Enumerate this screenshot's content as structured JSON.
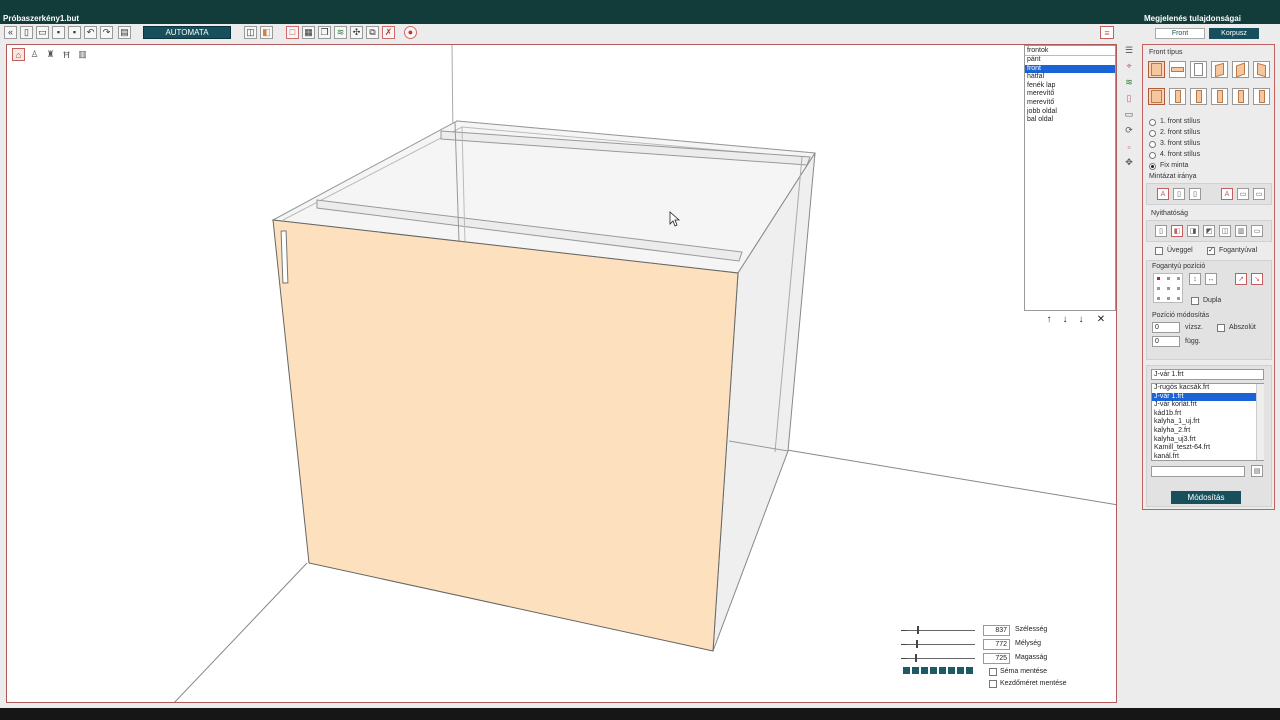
{
  "window": {
    "title": "Próbaszerkény1.but",
    "panel_title": "Megjelenés tulajdonságai"
  },
  "toolbar": {
    "mode_label": "AUTOMATA"
  },
  "fronts_list": {
    "title": "frontok",
    "items": [
      "pánt",
      "front",
      "hátfal",
      "fenék lap",
      "merevítő",
      "merevítő",
      "jobb oldal",
      "bal oldal"
    ],
    "selected_index": 1
  },
  "dimensions": {
    "width": {
      "value": "837",
      "label": "Szélesség",
      "slider": 0.2
    },
    "depth": {
      "value": "772",
      "label": "Mélység",
      "slider": 0.18
    },
    "height": {
      "value": "725",
      "label": "Magasság",
      "slider": 0.16
    },
    "save_scheme_label": "Séma mentése",
    "save_initial_size_label": "Kezdőméret mentése"
  },
  "props": {
    "tab_front": "Front",
    "tab_korpusz": "Korpusz",
    "front_type_label": "Front típus",
    "style_options": [
      "1. front stílus",
      "2. front stílus",
      "3. front stílus",
      "4. front stílus",
      "Fix minta"
    ],
    "style_selected": 4,
    "pattern_direction_label": "Mintázat iránya",
    "opening_label": "Nyithatóság",
    "glass_label": "Üveggel",
    "glass_checked": false,
    "handle_label": "Fogantyúval",
    "handle_checked": true,
    "handle_position_label": "Fogantyú pozíció",
    "double_label": "Dupla",
    "position_mod_label": "Pozíció módosítás",
    "horizontal_value": "0",
    "horizontal_label": "vízsz.",
    "vertical_value": "0",
    "vertical_label": "függ.",
    "absolute_label": "Abszolút",
    "file_value": "J-vár 1.frt",
    "files": [
      "J-rugós kacsák.frt",
      "J-vár 1.frt",
      "J-vár korlát.frt",
      "kád1b.frt",
      "kalyha_1_uj.frt",
      "kalyha_2.frt",
      "kalyha_uj3.frt",
      "Kamill_teszt-64.frt",
      "kanál.frt"
    ],
    "files_selected": 1,
    "search_value": "",
    "modify_label": "Módosítás"
  },
  "colors": {
    "accent": "#17505c",
    "front_fill": "#fde0bd",
    "selection": "#1a64d8",
    "border_red": "#c26060"
  }
}
